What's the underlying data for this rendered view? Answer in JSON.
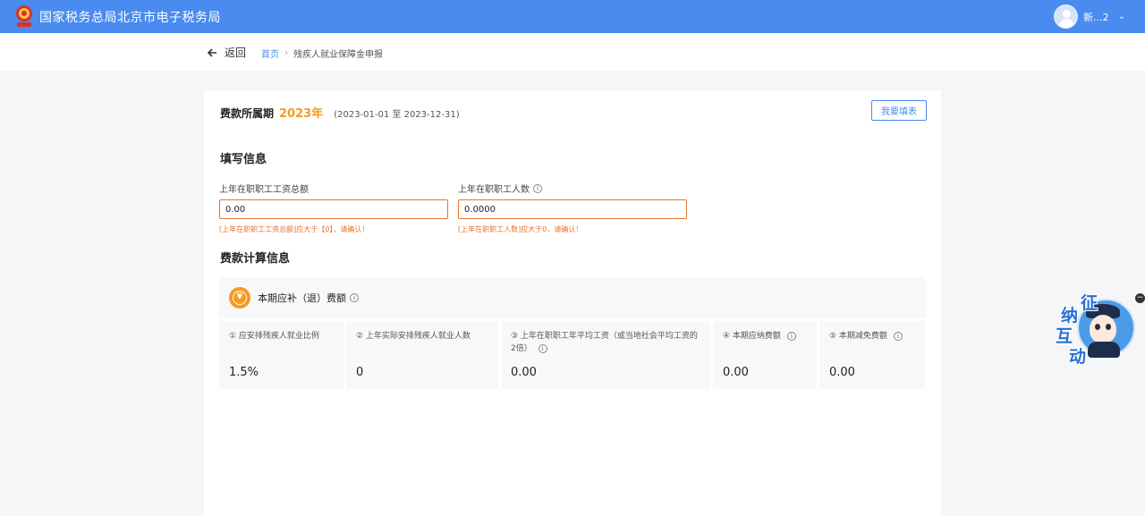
{
  "header": {
    "title": "国家税务总局北京市电子税务局",
    "user_name": "新...2",
    "chevron": "⌄"
  },
  "nav": {
    "back_label": "返回",
    "breadcrumb": [
      "首页",
      "残疾人就业保障金申报"
    ],
    "separator": "›"
  },
  "period": {
    "label": "费款所属期",
    "year": "2023年",
    "range": "(2023-01-01 至 2023-12-31)",
    "fill_button": "我要填表"
  },
  "fill_info": {
    "title": "填写信息",
    "fields": [
      {
        "label": "上年在职职工工资总额",
        "value": "0.00",
        "error": "[上年在职职工工资总额]应大于【0】，请确认！",
        "has_info": false
      },
      {
        "label": "上年在职职工人数",
        "value": "0.0000",
        "error": "[上年在职职工人数]应大于0，请确认！",
        "has_info": true
      }
    ]
  },
  "calc_info": {
    "title": "费款计算信息",
    "fee_header": "本期应补（退）费额",
    "coin_symbol": "¥",
    "items": [
      {
        "title": "① 应安排残疾人就业比例",
        "value": "1.5%"
      },
      {
        "title": "② 上年实际安排残疾人就业人数",
        "value": "0"
      },
      {
        "title": "③ 上年在职职工年平均工资（或当地社会平均工资的2倍）",
        "value": "0.00"
      },
      {
        "title": "④ 本期应纳费额",
        "value": "0.00"
      },
      {
        "title": "⑤ 本期减免费额",
        "value": "0.00"
      }
    ]
  },
  "widget": {
    "chars": [
      "征",
      "纳",
      "互",
      "动"
    ],
    "close": "−"
  },
  "colors": {
    "header_bg": "#4a8bef",
    "accent_orange": "#f59a23",
    "error": "#e8732a",
    "link": "#4a8bef"
  },
  "icons": {
    "info": "info-icon",
    "back": "arrow-left-icon",
    "coin": "yuan-coin-icon"
  }
}
